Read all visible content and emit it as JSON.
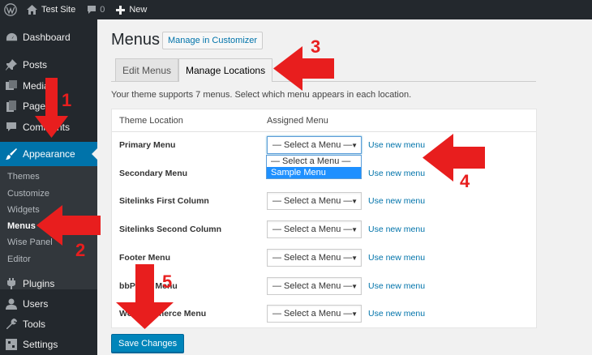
{
  "adminbar": {
    "site_name": "Test Site",
    "comment_count": "0",
    "new_label": "New"
  },
  "sidebar": {
    "items": [
      {
        "label": "Dashboard",
        "icon": "dashboard-icon"
      },
      {
        "label": "Posts",
        "icon": "pin-icon"
      },
      {
        "label": "Media",
        "icon": "media-icon"
      },
      {
        "label": "Pages",
        "icon": "pages-icon"
      },
      {
        "label": "Comments",
        "icon": "comment-icon"
      },
      {
        "label": "Appearance",
        "icon": "brush-icon"
      },
      {
        "label": "Plugins",
        "icon": "plug-icon"
      },
      {
        "label": "Users",
        "icon": "user-icon"
      },
      {
        "label": "Tools",
        "icon": "wrench-icon"
      },
      {
        "label": "Settings",
        "icon": "settings-icon"
      }
    ],
    "submenu": [
      "Themes",
      "Customize",
      "Widgets",
      "Menus",
      "Wise Panel",
      "Editor"
    ],
    "current_submenu": "Menus"
  },
  "main": {
    "title": "Menus",
    "customizer_button": "Manage in Customizer",
    "tabs": [
      {
        "label": "Edit Menus",
        "active": false
      },
      {
        "label": "Manage Locations",
        "active": true
      }
    ],
    "intro": "Your theme supports 7 menus. Select which menu appears in each location.",
    "table": {
      "headers": [
        "Theme Location",
        "Assigned Menu"
      ],
      "rows": [
        {
          "location": "Primary Menu",
          "selected": "— Select a Menu —",
          "link": "Use new menu"
        },
        {
          "location": "Secondary Menu",
          "selected": "",
          "link": "Use new menu"
        },
        {
          "location": "Sitelinks First Column",
          "selected": "— Select a Menu —",
          "link": "Use new menu"
        },
        {
          "location": "Sitelinks Second Column",
          "selected": "— Select a Menu —",
          "link": "Use new menu"
        },
        {
          "location": "Footer Menu",
          "selected": "— Select a Menu —",
          "link": "Use new menu"
        },
        {
          "location": "bbPress Menu",
          "selected": "— Select a Menu —",
          "link": "Use new menu"
        },
        {
          "location": "WooCommerce Menu",
          "selected": "— Select a Menu —",
          "link": "Use new menu"
        }
      ]
    },
    "dropdown_options": [
      "— Select a Menu —",
      "Sample Menu"
    ],
    "save_button": "Save Changes"
  },
  "annotations": {
    "steps": [
      "1",
      "2",
      "3",
      "4",
      "5"
    ],
    "arrow_color": "#e81e1e"
  }
}
